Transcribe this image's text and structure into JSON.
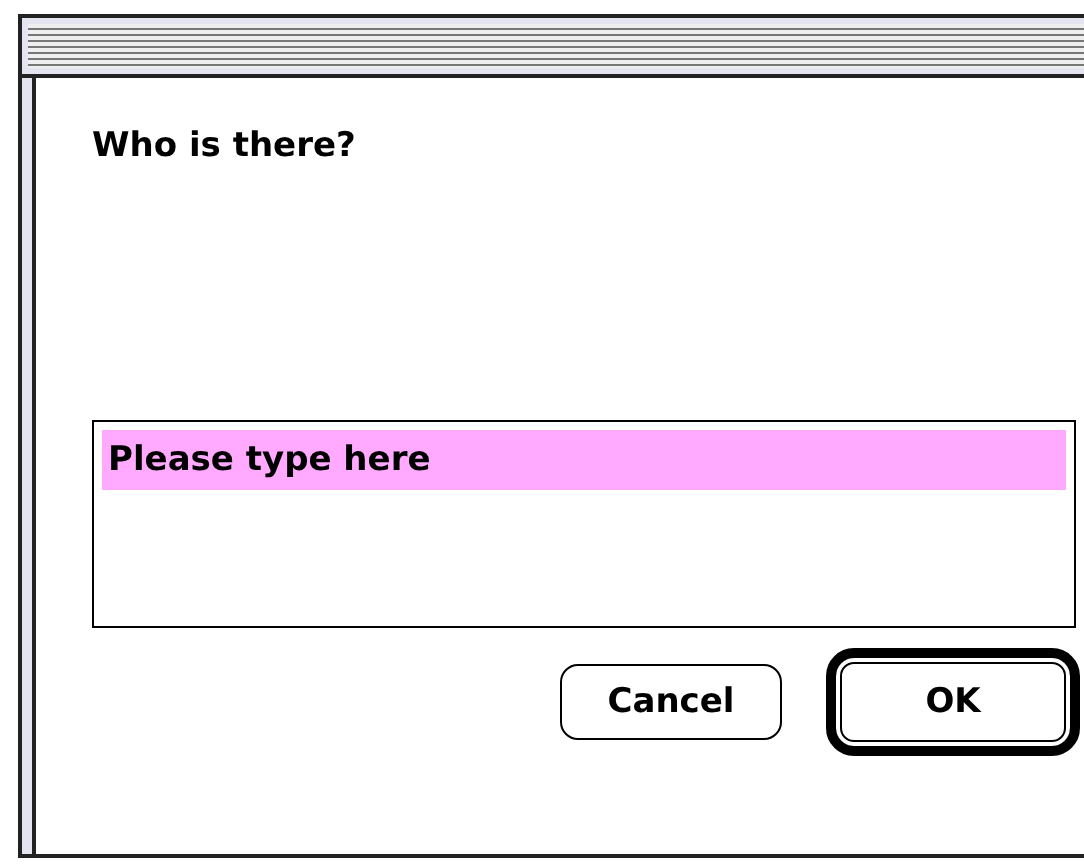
{
  "window": {
    "active": true
  },
  "prompt": "Who is there?",
  "field": {
    "value": "Please type here",
    "selected": true
  },
  "buttons": [
    {
      "label": "Cancel",
      "default": false
    },
    {
      "label": "OK",
      "default": true
    }
  ]
}
